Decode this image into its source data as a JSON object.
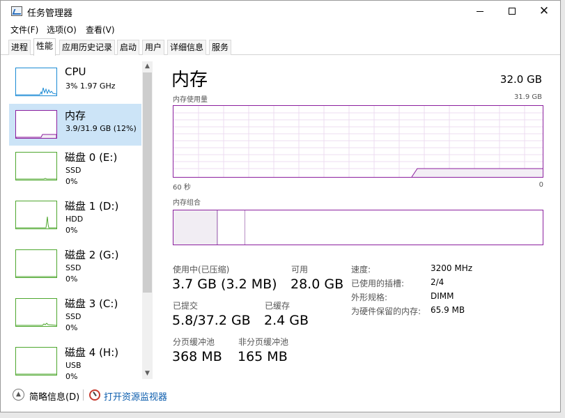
{
  "window": {
    "title": "任务管理器"
  },
  "menu": [
    "文件(F)",
    "选项(O)",
    "查看(V)"
  ],
  "tabs": [
    "进程",
    "性能",
    "应用历史记录",
    "启动",
    "用户",
    "详细信息",
    "服务"
  ],
  "active_tab": "性能",
  "sidebar": [
    {
      "title": "CPU",
      "line1": "3%  1.97 GHz",
      "line2": "",
      "color": "#1a8ad4"
    },
    {
      "title": "内存",
      "line1": "3.9/31.9 GB (12%)",
      "line2": "",
      "color": "#8b1e9e"
    },
    {
      "title": "磁盘 0 (E:)",
      "line1": "SSD",
      "line2": "0%",
      "color": "#4ea72e"
    },
    {
      "title": "磁盘 1 (D:)",
      "line1": "HDD",
      "line2": "0%",
      "color": "#4ea72e"
    },
    {
      "title": "磁盘 2 (G:)",
      "line1": "SSD",
      "line2": "0%",
      "color": "#4ea72e"
    },
    {
      "title": "磁盘 3 (C:)",
      "line1": "SSD",
      "line2": "0%",
      "color": "#4ea72e"
    },
    {
      "title": "磁盘 4 (H:)",
      "line1": "USB",
      "line2": "0%",
      "color": "#4ea72e"
    }
  ],
  "main": {
    "title": "内存",
    "total": "32.0 GB",
    "usage_label": "内存使用量",
    "usage_max": "31.9 GB",
    "time_left": "60 秒",
    "time_right": "0",
    "composition_label": "内存组合",
    "stats": {
      "in_use_label": "使用中(已压缩)",
      "in_use_value": "3.7 GB (3.2 MB)",
      "available_label": "可用",
      "available_value": "28.0 GB",
      "committed_label": "已提交",
      "committed_value": "5.8/37.2 GB",
      "cached_label": "已缓存",
      "cached_value": "2.4 GB",
      "paged_label": "分页缓冲池",
      "paged_value": "368 MB",
      "nonpaged_label": "非分页缓冲池",
      "nonpaged_value": "165 MB"
    },
    "details": [
      {
        "key": "速度:",
        "value": "3200 MHz"
      },
      {
        "key": "已使用的插槽:",
        "value": "2/4"
      },
      {
        "key": "外形规格:",
        "value": "DIMM"
      },
      {
        "key": "为硬件保留的内存:",
        "value": "65.9 MB"
      }
    ]
  },
  "footer": {
    "less_details": "简略信息(D)",
    "open_monitor": "打开资源监视器"
  },
  "colors": {
    "memory": "#8b1e9e",
    "cpu": "#1a8ad4",
    "disk": "#4ea72e",
    "selected": "#cce4f7",
    "link": "#0b5cad"
  }
}
